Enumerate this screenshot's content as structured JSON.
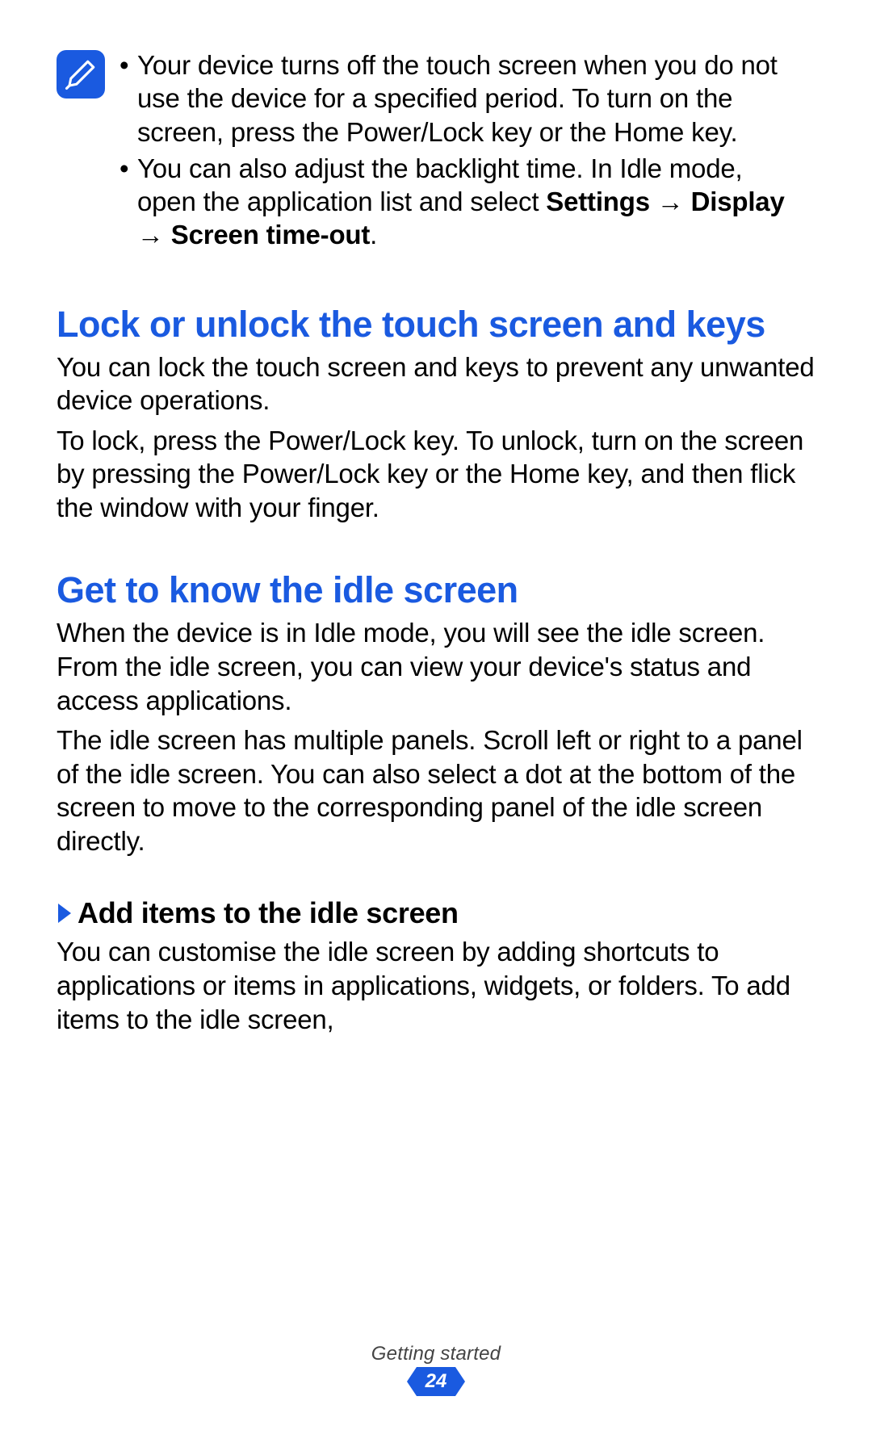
{
  "note": {
    "bullets": [
      {
        "plain": "Your device turns off the touch screen when you do not use the device for a specified period. To turn on the screen, press the Power/Lock key or the Home key."
      },
      {
        "pre": "You can also adjust the backlight time. In Idle mode, open the application list and select ",
        "bold1": "Settings",
        "arrow1": " → ",
        "bold2": "Display",
        "arrow2": " → ",
        "bold3": "Screen time-out",
        "post": "."
      }
    ]
  },
  "section_lock": {
    "heading": "Lock or unlock the touch screen and keys",
    "p1": "You can lock the touch screen and keys to prevent any unwanted device operations.",
    "p2": "To lock, press the Power/Lock key. To unlock, turn on the screen by pressing the Power/Lock key or the Home key, and then flick the window with your finger."
  },
  "section_idle": {
    "heading": "Get to know the idle screen",
    "p1": "When the device is in Idle mode, you will see the idle screen. From the idle screen, you can view your device's status and access applications.",
    "p2": "The idle screen has multiple panels. Scroll left or right to a panel of the idle screen. You can also select a dot at the bottom of the screen to move to the corresponding panel of the idle screen directly."
  },
  "subsection_add": {
    "title": "Add items to the idle screen",
    "p1": "You can customise the idle screen by adding shortcuts to applications or items in applications, widgets, or folders. To add items to the idle screen,"
  },
  "footer": {
    "label": "Getting started",
    "page": "24"
  }
}
